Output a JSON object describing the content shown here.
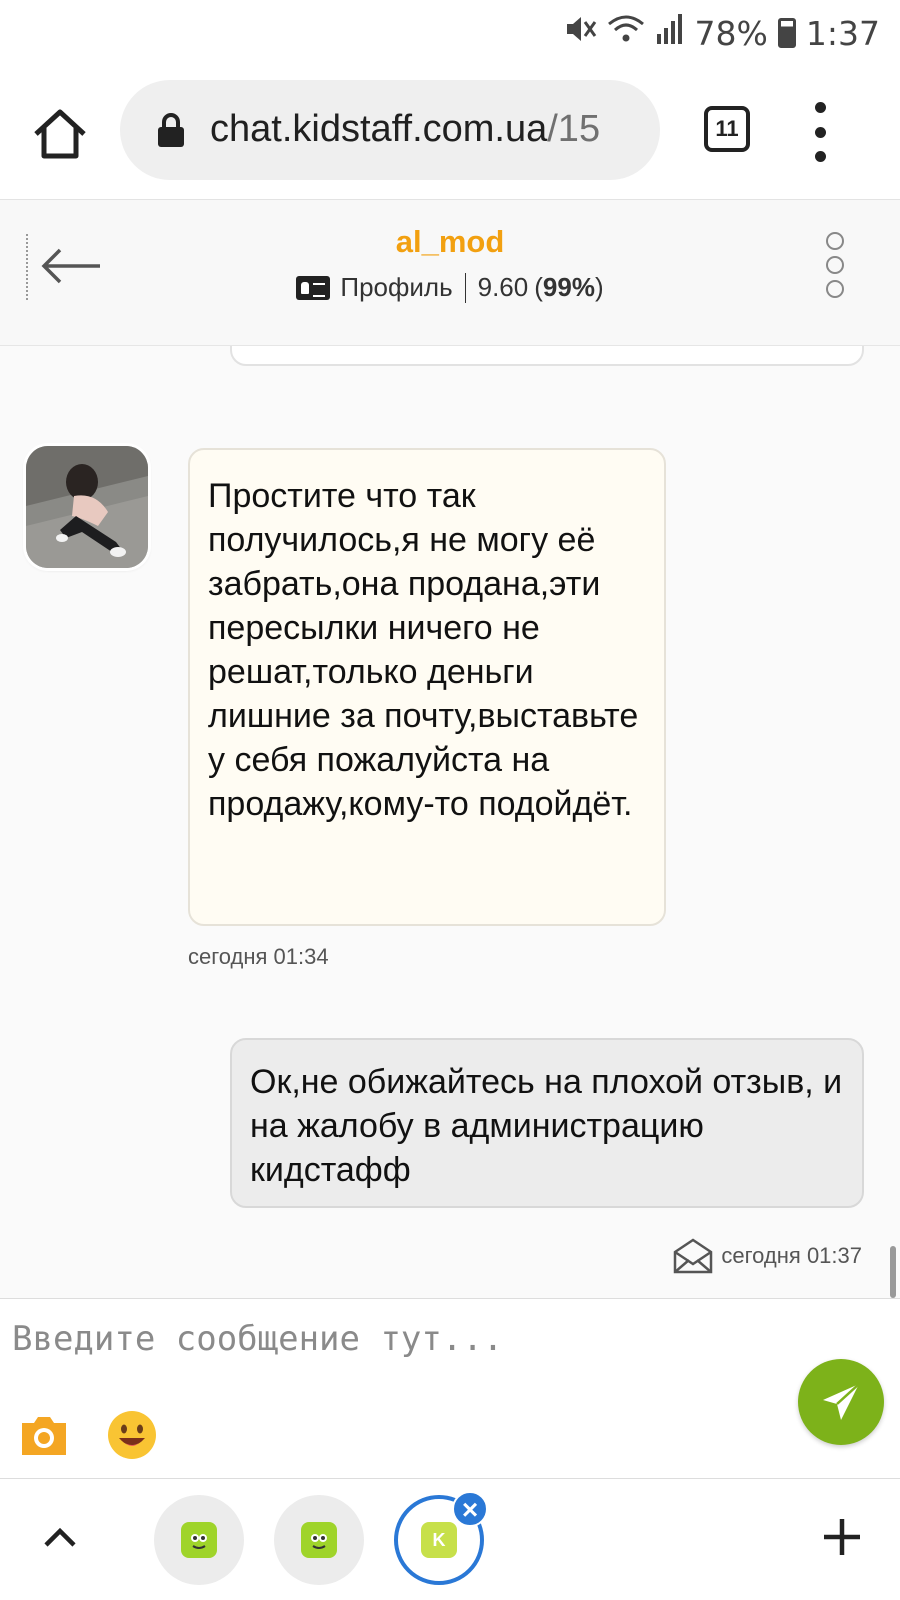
{
  "status_bar": {
    "battery": "78%",
    "time": "1:37"
  },
  "browser": {
    "url_domain": "chat.kidstaff.com.ua",
    "url_rest": "/15",
    "tab_count": "11"
  },
  "chat_header": {
    "username": "al_mod",
    "profile_label": "Профиль",
    "rating_value": "9.60",
    "rating_percent": "99%"
  },
  "messages": {
    "incoming": {
      "text": "Простите что так получилось,я не могу её забрать,она продана,эти пересылки ничего не решат,только деньги лишние за почту,выставьте у себя пожалуйста на продажу,кому-то подойдёт.",
      "time": "сегодня 01:34"
    },
    "outgoing": {
      "text": "Ок,не обижайтесь на плохой отзыв, и на жалобу в администрацию кидстафф",
      "time": "сегодня 01:37"
    }
  },
  "composer": {
    "placeholder": "Введите сообщение тут..."
  },
  "bottom_bar": {
    "active_tab_letter": "K"
  },
  "colors": {
    "accent_orange": "#f2a010",
    "send_green": "#7db21a",
    "active_blue": "#2a78d6"
  }
}
